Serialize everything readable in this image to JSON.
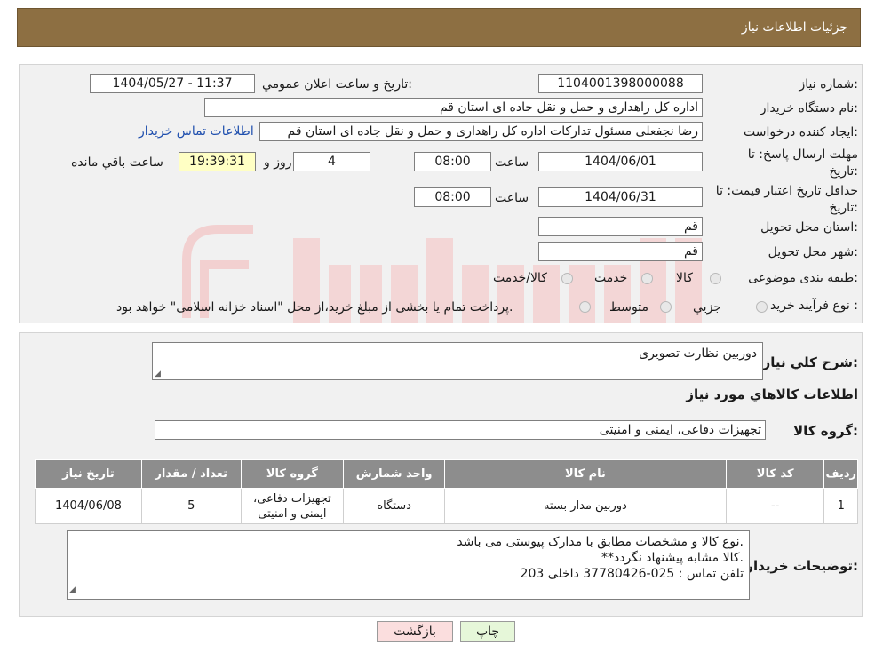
{
  "header": {
    "title": "جزئیات اطلاعات نیاز"
  },
  "form": {
    "need_no_label": "شماره نیاز:",
    "need_no": "1104001398000088",
    "announce_label": "تاریخ و ساعت اعلان عمومي:",
    "announce_value": "1404/05/27 - 11:37",
    "buyer_label": "نام دستگاه خریدار:",
    "buyer_value": "اداره کل راهداری و حمل و نقل جاده ای استان قم",
    "creator_label": "ایجاد کننده درخواست:",
    "creator_value": "رضا  نجفعلی مسئول تداركات اداره کل راهداری و حمل و نقل جاده ای استان قم",
    "contact_link": "اطلاعات تماس خریدار",
    "deadline_label": "مهلت ارسال پاسخ: تا تاریخ:",
    "deadline_date": "1404/06/01",
    "time_label": "ساعت",
    "deadline_time": "08:00",
    "days": "4",
    "days_label": "روز و",
    "remaining": "19:39:31",
    "remaining_label": "ساعت باقي مانده",
    "validity_label": "حداقل تاریخ اعتبار قیمت: تا تاریخ:",
    "validity_date": "1404/06/31",
    "validity_time": "08:00",
    "province_label": "استان محل تحویل:",
    "province_value": "قم",
    "city_label": "شهر محل تحویل:",
    "city_value": "قم",
    "category_label": "طبقه بندی موضوعی:",
    "category_options": [
      "کالا",
      "خدمت",
      "کالا/خدمت"
    ],
    "process_label": "نوع فرآیند خرید :",
    "process_options": [
      "جزيي",
      "متوسط"
    ],
    "process_note": "پرداخت تمام یا بخشی از مبلغ خرید،از محل \"اسناد خزانه اسلامی\" خواهد بود."
  },
  "details": {
    "summary_label": "شرح کلي نياز:",
    "summary_value": "دوربین نظارت تصویری",
    "items_title": "اطلاعات کالاهاي مورد نياز",
    "group_label": "گروه کالا:",
    "group_value": "تجهیزات دفاعی، ایمنی و امنیتی",
    "table": {
      "headers": [
        "رديف",
        "کد کالا",
        "نام کالا",
        "واحد شمارش",
        "گروه کالا",
        "تعداد / مقدار",
        "تاریخ نیاز"
      ],
      "rows": [
        [
          "1",
          "--",
          "دوربین مدار بسته",
          "دستگاه",
          "تجهیزات دفاعی، ایمنی و امنیتی",
          "5",
          "1404/06/08"
        ]
      ]
    },
    "notes_label": "توضيحات خريدار:",
    "notes_lines": [
      "نوع کالا و مشخصات مطابق با مدارک پیوستی می باشد.",
      "**کالا مشابه پیشنهاد نگردد.",
      "تلفن تماس : 025-37780426 داخلی 203"
    ]
  },
  "buttons": {
    "print": "چاپ",
    "back": "بازگشت"
  },
  "colors": {
    "header": "#8d6f42",
    "table_header": "#8d8d8d",
    "link": "#1f4fae",
    "timer": "#ffffc4",
    "print_btn": "#e6f7d9",
    "back_btn": "#fbdede"
  },
  "icons": {
    "resize": "resize-grip-icon",
    "radio": "radio-icon"
  }
}
